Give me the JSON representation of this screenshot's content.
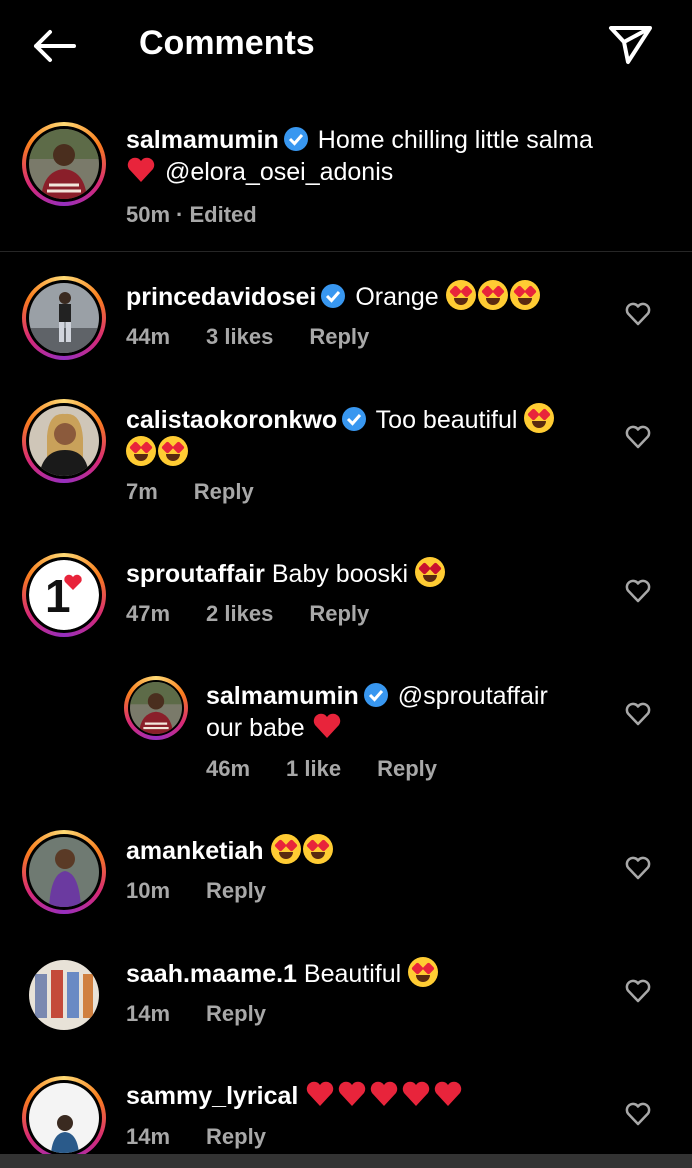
{
  "header": {
    "title": "Comments"
  },
  "caption": {
    "username": "salmamumin",
    "text": "Home chilling little salma",
    "mention": "@elora_osei_adonis",
    "time": "50m",
    "edited": "· Edited"
  },
  "comments": [
    {
      "username": "princedavidosei",
      "text": "Orange",
      "time": "44m",
      "likes": "3 likes",
      "reply": "Reply"
    },
    {
      "username": "calistaokoronkwo",
      "text": "Too beautiful",
      "time": "7m",
      "reply": "Reply"
    },
    {
      "username": "sproutaffair",
      "text": "Baby booski",
      "time": "47m",
      "likes": "2 likes",
      "reply": "Reply"
    },
    {
      "username": "salmamumin",
      "mention": "@sproutaffair",
      "text": "our babe",
      "time": "46m",
      "likes": "1 like",
      "reply": "Reply"
    },
    {
      "username": "amanketiah",
      "time": "10m",
      "reply": "Reply"
    },
    {
      "username": "saah.maame.1",
      "text": "Beautiful",
      "time": "14m",
      "reply": "Reply"
    },
    {
      "username": "sammy_lyrical",
      "time": "14m",
      "reply": "Reply"
    }
  ],
  "icons": {
    "back": "arrow-left-icon",
    "share": "paper-plane-icon",
    "like": "heart-outline-icon",
    "verified": "verified-badge-icon"
  },
  "colors": {
    "background": "#000000",
    "meta_text": "#a8a8a8",
    "verified": "#3897f0",
    "heart": "#e8243b"
  }
}
